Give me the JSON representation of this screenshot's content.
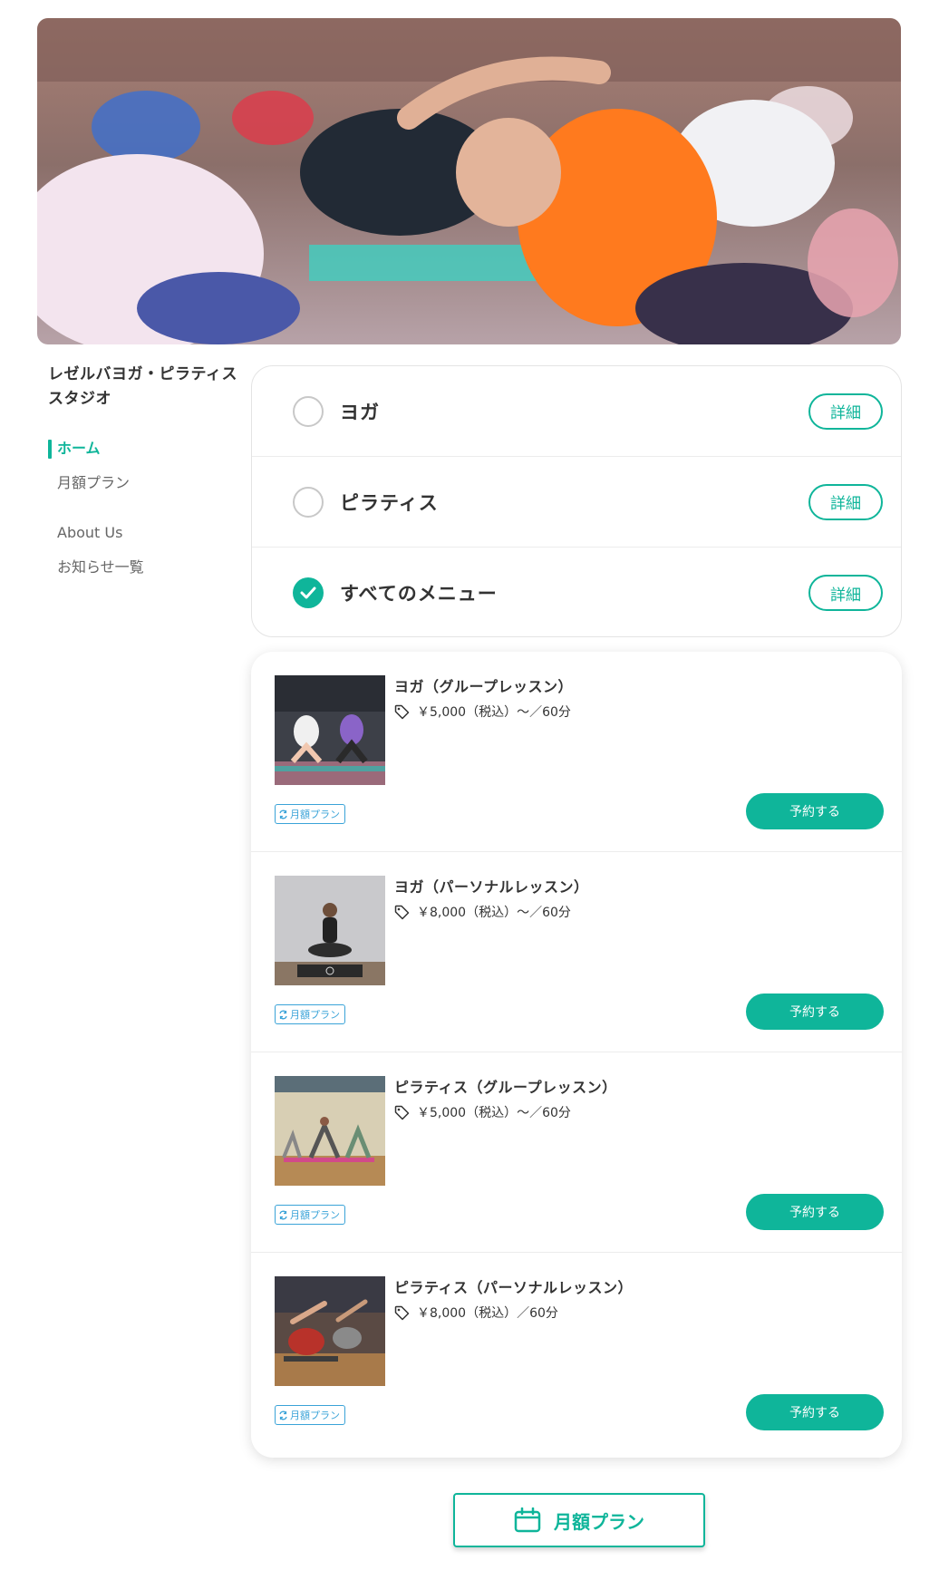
{
  "hero": {
    "alt": "yoga-class-photo"
  },
  "sidebar": {
    "studio_name": "レゼルバヨガ・ピラティススタジオ",
    "nav": [
      {
        "label": "ホーム",
        "active": true
      },
      {
        "label": "月額プラン",
        "active": false
      },
      {
        "label": "About Us",
        "active": false
      },
      {
        "label": "お知らせ一覧",
        "active": false
      }
    ]
  },
  "categories": [
    {
      "label": "ヨガ",
      "checked": false,
      "detail_label": "詳細"
    },
    {
      "label": "ピラティス",
      "checked": false,
      "detail_label": "詳細"
    },
    {
      "label": "すべてのメニュー",
      "checked": true,
      "detail_label": "詳細"
    }
  ],
  "menus": [
    {
      "title": "ヨガ（グループレッスン）",
      "price": "￥5,000（税込）〜／60分",
      "badge": "月額プラン",
      "button": "予約する",
      "thumb_icon": "yoga-group-thumbnail"
    },
    {
      "title": "ヨガ（パーソナルレッスン）",
      "price": "￥8,000（税込）〜／60分",
      "badge": "月額プラン",
      "button": "予約する",
      "thumb_icon": "yoga-personal-thumbnail"
    },
    {
      "title": "ピラティス（グループレッスン）",
      "price": "￥5,000（税込）〜／60分",
      "badge": "月額プラン",
      "button": "予約する",
      "thumb_icon": "pilates-group-thumbnail"
    },
    {
      "title": "ピラティス（パーソナルレッスン）",
      "price": "￥8,000（税込）／60分",
      "badge": "月額プラン",
      "button": "予約する",
      "thumb_icon": "pilates-personal-thumbnail"
    }
  ],
  "monthly_button": {
    "label": "月額プラン",
    "icon": "calendar-icon"
  },
  "colors": {
    "accent": "#0fb59a",
    "badge": "#3aa3d8",
    "text": "#333333"
  }
}
